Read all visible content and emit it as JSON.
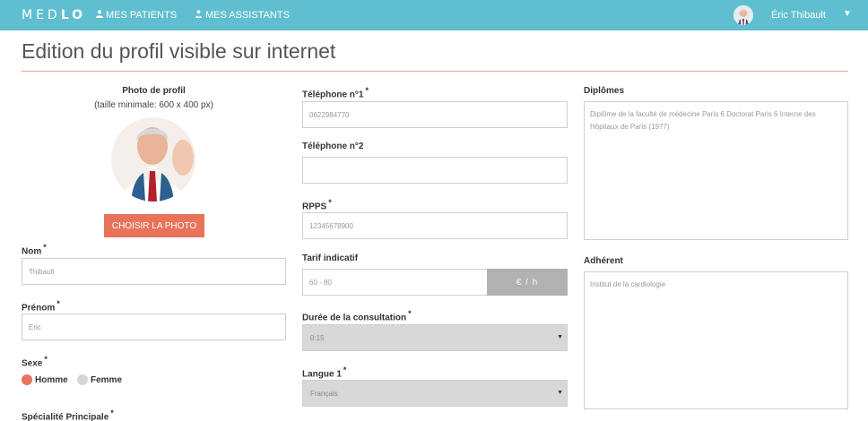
{
  "nav": {
    "brand_light": "MED",
    "brand_bold": "LO",
    "links": [
      {
        "label": "MES PATIENTS",
        "icon": "user-icon"
      },
      {
        "label": "MES ASSISTANTS",
        "icon": "users-icon"
      }
    ],
    "user_name": "Éric Thibault",
    "caret": "▼"
  },
  "page": {
    "title": "Edition du profil visible sur internet"
  },
  "photo": {
    "label": "Photo de profil",
    "hint": "(taille minimale: 600 x 400 px)",
    "button": "CHOISIR LA PHOTO"
  },
  "colors": {
    "navbar": "#5fbfd0",
    "accent": "#e8735a",
    "title_rule": "#e7a896"
  },
  "fields": {
    "nom": {
      "label": "Nom",
      "required": "*",
      "value": "Thibault"
    },
    "prenom": {
      "label": "Prénom",
      "required": "*",
      "value": "Eric"
    },
    "sexe": {
      "label": "Sexe",
      "required": "*",
      "options": [
        "Homme",
        "Femme"
      ],
      "selected": "Homme"
    },
    "specialite": {
      "label": "Spécialité Principale",
      "required": "*"
    },
    "tel1": {
      "label": "Téléphone n°1",
      "required": "*",
      "value": "0622984770"
    },
    "tel2": {
      "label": "Téléphone n°2",
      "value": ""
    },
    "rpps": {
      "label": "RPPS",
      "required": "*",
      "value": "12345678900"
    },
    "tarif": {
      "label": "Tarif indicatif",
      "value": "60 - 80",
      "unit": "€ / h"
    },
    "duree": {
      "label": "Durée de la consultation",
      "required": "*",
      "value": "0:15"
    },
    "langue": {
      "label": "Langue 1",
      "required": "*",
      "value": "Français"
    },
    "diplomes": {
      "label": "Diplômes",
      "value": "Diplôme de la faculté de médecine Paris 6 Doctorat Paris 6 Interne des Hôpitaux de Paris (1977)"
    },
    "adherent": {
      "label": "Adhérent",
      "value": "Institut de la cardiologie"
    }
  }
}
